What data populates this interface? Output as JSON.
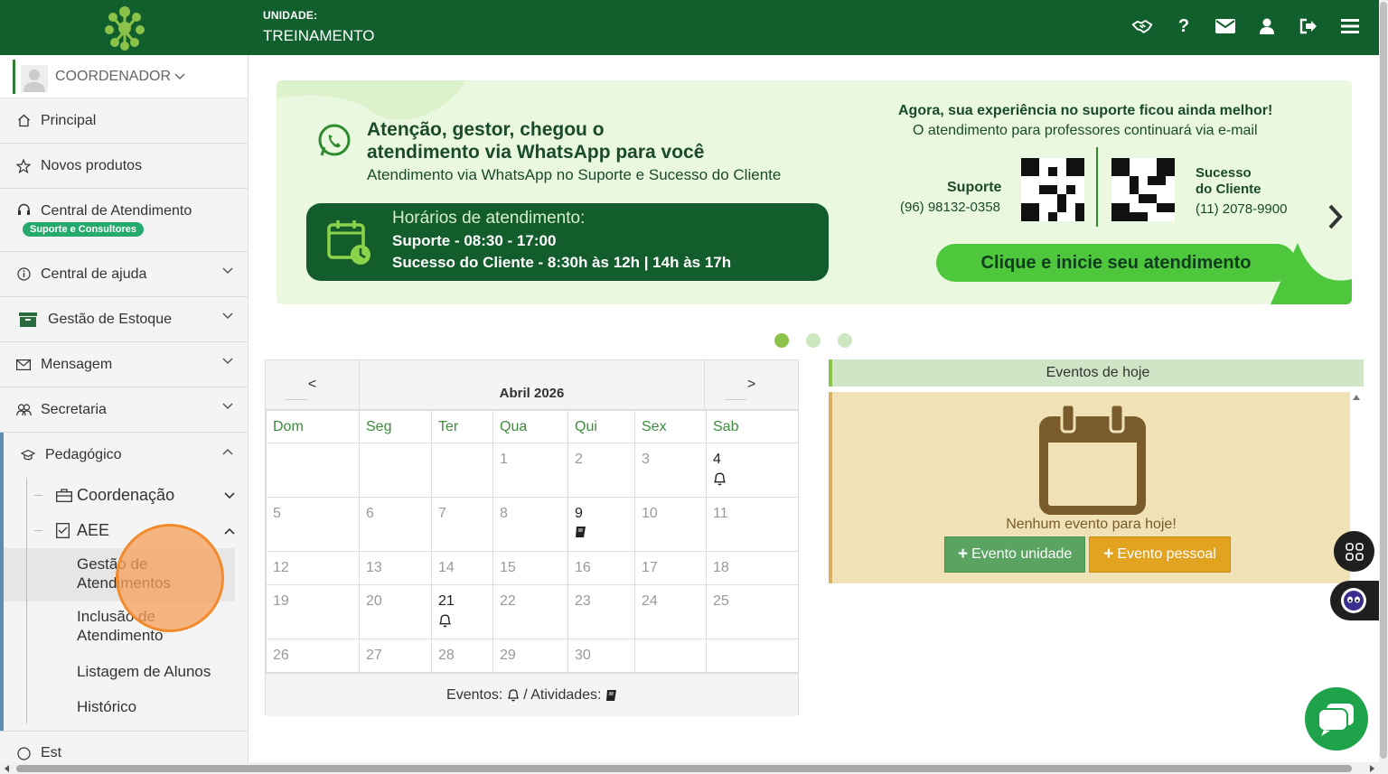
{
  "header": {
    "logo_icon": "network-logo-icon",
    "unit_label": "UNIDADE:",
    "unit_value": "TREINAMENTO",
    "icons": [
      "handshake-icon",
      "help-icon",
      "envelope-icon",
      "user-icon",
      "logout-icon",
      "menu-icon"
    ]
  },
  "sidebar": {
    "user": "COORDENADOR",
    "items": [
      {
        "label": "Principal",
        "icon": "home-icon"
      },
      {
        "label": "Novos produtos",
        "icon": "star-icon"
      },
      {
        "label": "Central de Atendimento",
        "icon": "headset-icon",
        "badge": "Suporte e Consultores"
      },
      {
        "label": "Central de ajuda",
        "icon": "info-icon"
      },
      {
        "label": "Gestão de Estoque",
        "icon": "archive-icon"
      },
      {
        "label": "Mensagem",
        "icon": "envelope-icon"
      },
      {
        "label": "Secretaria",
        "icon": "users-icon"
      },
      {
        "label": "Pedagógico",
        "icon": "graduation-icon"
      }
    ],
    "pedagogico": {
      "coordenacao": "Coordenação",
      "aee": "AEE",
      "leaves": [
        "Gestão de Atendimentos",
        "Inclusão de Atendimento",
        "Listagem de Alunos",
        "Histórico"
      ]
    },
    "next_item_partial": "Est"
  },
  "banner": {
    "title_line1": "Atenção, gestor, chegou o",
    "title_line2": "atendimento via WhatsApp para você",
    "subtitle": "Atendimento via WhatsApp no Suporte e Sucesso do Cliente",
    "hours_title": "Horários de atendimento:",
    "hours_support": "Suporte - 08:30 - 17:00",
    "hours_success": "Sucesso do Cliente - 8:30h às 12h | 14h às 17h",
    "right_title": "Agora, sua experiência no suporte ficou ainda melhor!",
    "right_sub": "O atendimento para professores continuará via e-mail",
    "support_label": "Suporte",
    "support_phone": "(96) 98132-0358",
    "success_label1": "Sucesso",
    "success_label2": "do Cliente",
    "success_phone": "(11) 2078-9900",
    "cta": "Clique e inicie seu atendimento",
    "active_slide": 0,
    "slides": 3
  },
  "calendar": {
    "prev": "<",
    "next": ">",
    "title": "Abril 2026",
    "weekdays": [
      "Dom",
      "Seg",
      "Ter",
      "Qua",
      "Qui",
      "Sex",
      "Sab"
    ],
    "weeks": [
      [
        "",
        "",
        "",
        "1",
        "2",
        "3",
        "4"
      ],
      [
        "5",
        "6",
        "7",
        "8",
        "9",
        "10",
        "11"
      ],
      [
        "12",
        "13",
        "14",
        "15",
        "16",
        "17",
        "18"
      ],
      [
        "19",
        "20",
        "21",
        "22",
        "23",
        "24",
        "25"
      ],
      [
        "26",
        "27",
        "28",
        "29",
        "30",
        "",
        ""
      ]
    ],
    "events_days": [
      "4",
      "21"
    ],
    "activity_days": [
      "9"
    ],
    "legend_events": "Eventos:",
    "legend_sep": "/ Atividades:"
  },
  "events": {
    "title": "Eventos de hoje",
    "empty": "Nenhum evento para hoje!",
    "btn_unit": "Evento unidade",
    "btn_personal": "Evento pessoal"
  },
  "colors": {
    "header": "#115f2d",
    "accent_green": "#8bc34a",
    "events_bg": "#f0e1b6",
    "btn_unit": "#5aa361",
    "btn_personal": "#e2a321"
  }
}
